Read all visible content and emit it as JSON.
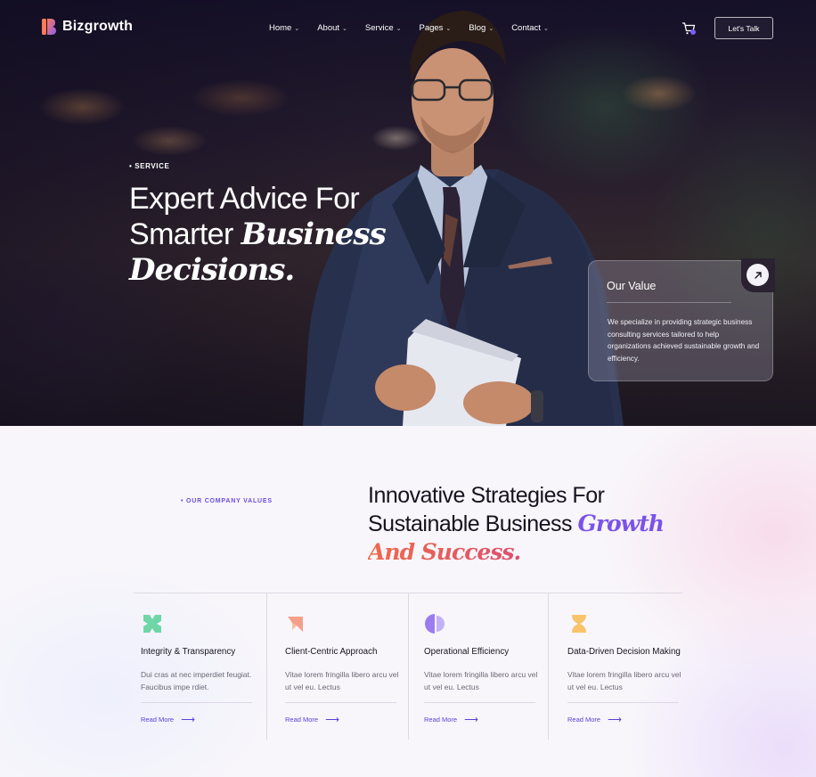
{
  "brand": {
    "name": "Bizgrowth"
  },
  "nav": {
    "items": [
      {
        "label": "Home"
      },
      {
        "label": "About"
      },
      {
        "label": "Service"
      },
      {
        "label": "Pages"
      },
      {
        "label": "Blog"
      },
      {
        "label": "Contact"
      }
    ],
    "cta_label": "Let's Talk"
  },
  "hero": {
    "eyebrow": "• SERVICE",
    "title_line1": "Expert Advice For",
    "title_line2_plain": "Smarter ",
    "title_line2_italic": "Business",
    "title_line3_italic": "Decisions."
  },
  "value_card": {
    "title": "Our Value",
    "description": "We specialize in providing strategic business consulting services tailored to help organizations achieved  sustainable growth and efficiency."
  },
  "values_section": {
    "eyebrow": "• OUR COMPANY VALUES",
    "title_line1": "Innovative Strategies For",
    "title_line2_plain": "Sustainable Business ",
    "title_line2_italic": "Growth",
    "title_line3_italic": "And Success."
  },
  "cards": [
    {
      "title": "Integrity & Transparency",
      "description": "Dui cras at nec imperdiet feugiat. Faucibus impe rdiet.",
      "link": "Read More",
      "icon": "x-shape-icon",
      "color": "#6fd6a6"
    },
    {
      "title": "Client-Centric Approach",
      "description": "Vitae lorem fringilla libero arcu vel ut vel eu. Lectus",
      "link": "Read More",
      "icon": "chevron-shape-icon",
      "color": "#f5a08a"
    },
    {
      "title": "Operational Efficiency",
      "description": "Vitae lorem fringilla libero arcu vel ut vel eu. Lectus",
      "link": "Read More",
      "icon": "split-circle-icon",
      "color": "#9b7cf0"
    },
    {
      "title": "Data-Driven Decision Making",
      "description": "Vitae lorem fringilla libero arcu vel ut vel eu. Lectus",
      "link": "Read More",
      "icon": "hourglass-icon",
      "color": "#f7c46a"
    }
  ],
  "colors": {
    "accent": "#7a52ea",
    "link": "#5a3fd8"
  }
}
